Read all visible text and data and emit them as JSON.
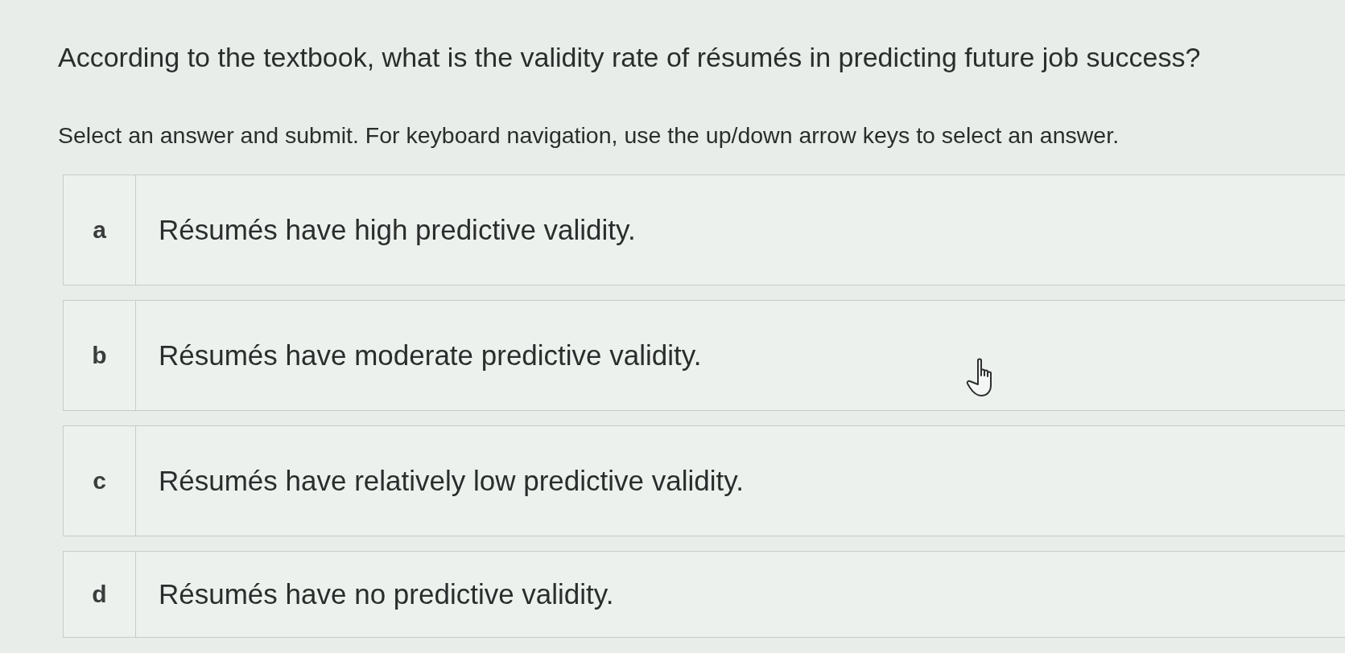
{
  "question": "According to the textbook, what is the validity rate of résumés in predicting future job success?",
  "instructions": "Select an answer and submit. For keyboard navigation, use the up/down arrow keys to select an answer.",
  "options": [
    {
      "letter": "a",
      "text": "Résumés have high predictive validity.",
      "selected": false
    },
    {
      "letter": "b",
      "text": "Résumés have moderate predictive validity.",
      "selected": false
    },
    {
      "letter": "c",
      "text": "Résumés have relatively low predictive validity.",
      "selected": false
    },
    {
      "letter": "d",
      "text": "Résumés have no predictive validity.",
      "selected": false
    }
  ]
}
